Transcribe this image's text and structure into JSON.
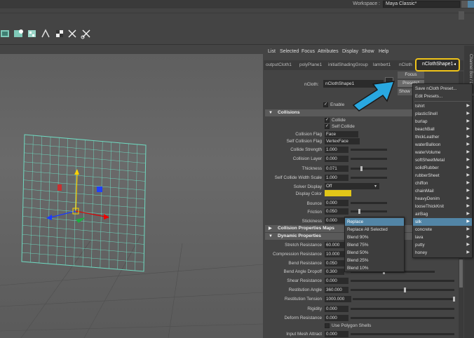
{
  "workspace": {
    "label": "Workspace :",
    "value": "Maya Classic*"
  },
  "ae_menu": [
    "List",
    "Selected",
    "Focus",
    "Attributes",
    "Display",
    "Show",
    "Help"
  ],
  "node_tabs": [
    "outputCloth1",
    "polyPlane1",
    "initialShadingGroup",
    "lambert1",
    "nCloth"
  ],
  "active_tab": "nClothShape1",
  "node_field": {
    "label": "nCloth:",
    "value": "nClothShape1"
  },
  "side_buttons": {
    "focus": "Focus",
    "presets": "Presets*",
    "show": "Show"
  },
  "enable": {
    "label": "Enable",
    "checked": true
  },
  "sections": {
    "collisions": "Collisions",
    "collision_maps": "Collision Properties Maps",
    "dynamic": "Dynamic Properties"
  },
  "collide": {
    "label": "Collide"
  },
  "self_collide": {
    "label": "Self Collide"
  },
  "attributes": {
    "collision_flag": {
      "label": "Collision Flag",
      "value": "Face"
    },
    "self_collision_flag": {
      "label": "Self Collision Flag",
      "value": "VertexFace"
    },
    "collide_strength": {
      "label": "Collide Strength",
      "value": "1.000"
    },
    "collision_layer": {
      "label": "Collision Layer",
      "value": "0.000"
    },
    "thickness": {
      "label": "Thickness",
      "value": "0.071"
    },
    "self_collide_width_scale": {
      "label": "Self Collide Width Scale",
      "value": "1.000"
    },
    "solver_display": {
      "label": "Solver Display",
      "value": "Off"
    },
    "display_color": {
      "label": "Display Color",
      "color": "#e2c718"
    },
    "bounce": {
      "label": "Bounce",
      "value": "0.000"
    },
    "friction": {
      "label": "Friction",
      "value": "0.050"
    },
    "stickiness": {
      "label": "Stickiness",
      "value": "0.000"
    },
    "stretch_resistance": {
      "label": "Stretch Resistance",
      "value": "60.000"
    },
    "compression_resistance": {
      "label": "Compression Resistance",
      "value": "10.000"
    },
    "bend_resistance": {
      "label": "Bend Resistance",
      "value": "0.050"
    },
    "bend_angle_dropoff": {
      "label": "Bend Angle Dropoff",
      "value": "0.300"
    },
    "shear_resistance": {
      "label": "Shear Resistance",
      "value": "0.000"
    },
    "restitution_angle": {
      "label": "Restitution Angle",
      "value": "360.000"
    },
    "restitution_tension": {
      "label": "Restitution Tension",
      "value": "1000.000"
    },
    "rigidity": {
      "label": "Rigidity",
      "value": "0.000"
    },
    "deform_resistance": {
      "label": "Deform Resistance",
      "value": "0.000"
    },
    "use_polygon_shells": {
      "label": "Use Polygon Shells"
    },
    "input_mesh_attract": {
      "label": "Input Mesh Attract",
      "value": "0.000"
    }
  },
  "preset_menu": {
    "top": [
      "Save nCloth Preset...",
      "Edit Presets..."
    ],
    "items": [
      "tshirt",
      "plasticShell",
      "burlap",
      "beachBall",
      "thickLeather",
      "waterBalloon",
      "waterVolume",
      "softSheetMetal",
      "solidRubber",
      "rubberSheet",
      "chiffon",
      "chainMail",
      "heavyDenim",
      "looseThickKnit",
      "airBag",
      "silk",
      "concrete",
      "lava",
      "putty",
      "honey"
    ],
    "selected": "silk"
  },
  "blend_menu": {
    "items": [
      "Replace",
      "Replace All Selected",
      "Blend 90%",
      "Blend 75%",
      "Blend 50%",
      "Blend 25%",
      "Blend 10%"
    ],
    "selected": "Replace"
  },
  "side_panel_tabs": [
    "Channel Box / Layer Editor"
  ],
  "colors": {
    "accent": "#5285a6",
    "highlight": "#f0c419",
    "arrow": "#29a8e0",
    "grid": "#6fd9c0"
  }
}
